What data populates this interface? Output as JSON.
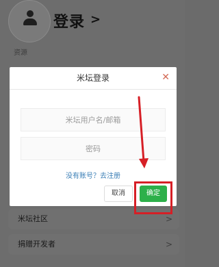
{
  "header": {
    "title": "登录",
    "arrow": ">"
  },
  "section": {
    "label": "资源"
  },
  "background_rows": [
    {
      "label": "米坛社区",
      "chevron": ">"
    },
    {
      "label": "捐赠开发者",
      "chevron": ">"
    }
  ],
  "dialog": {
    "title": "米坛登录",
    "close_glyph": "✕",
    "username_placeholder": "米坛用户名/邮箱",
    "password_placeholder": "密码",
    "register_link": "没有账号？去注册",
    "cancel_label": "取消",
    "confirm_label": "确定"
  },
  "colors": {
    "confirm": "#2db04a",
    "annotation": "#d61f26",
    "link": "#3b7fb6",
    "close": "#d36a56"
  }
}
